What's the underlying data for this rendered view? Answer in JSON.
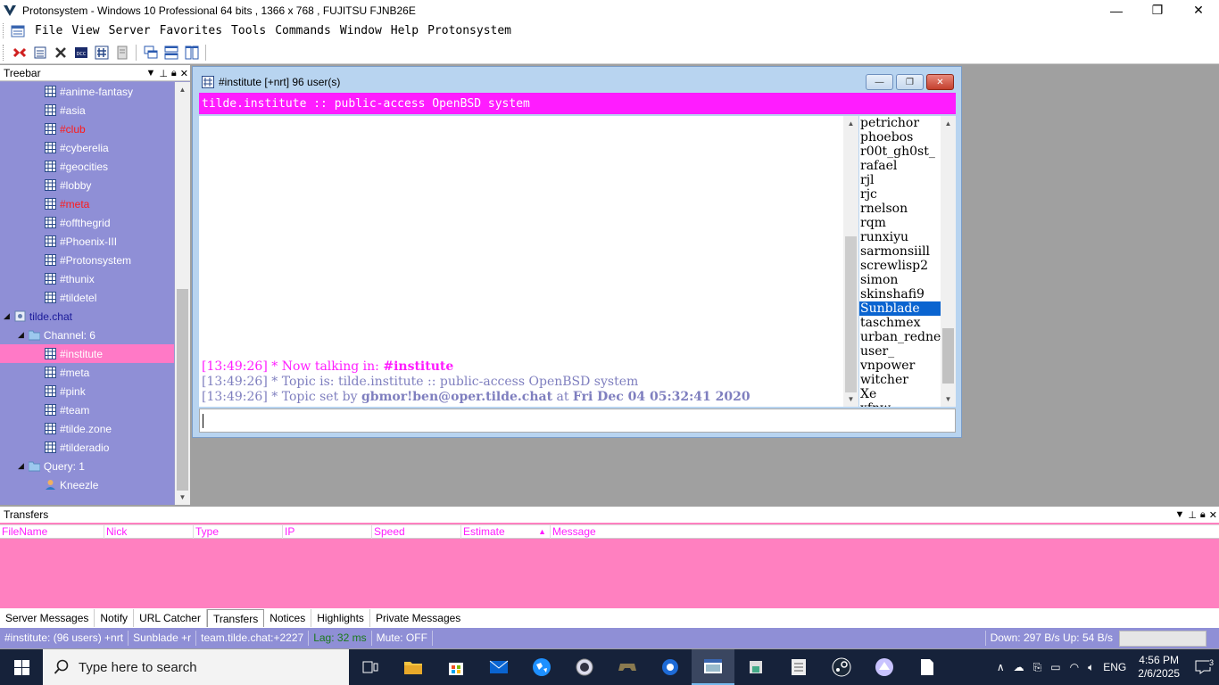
{
  "app": {
    "title": "Protonsystem - Windows 10 Professional 64 bits , 1366 x 768 , FUJITSU FJNB26E",
    "window_buttons": {
      "minimize": "—",
      "restore": "❐",
      "close": "✕"
    }
  },
  "menu": [
    "File",
    "View",
    "Server",
    "Favorites",
    "Tools",
    "Commands",
    "Window",
    "Help",
    "Protonsystem"
  ],
  "treebar": {
    "header": "Treebar",
    "items": [
      {
        "label": "#anime-fantasy",
        "kind": "channel",
        "indent": 2,
        "state": "normal"
      },
      {
        "label": "#asia",
        "kind": "channel",
        "indent": 2,
        "state": "normal"
      },
      {
        "label": "#club",
        "kind": "channel",
        "indent": 2,
        "state": "red"
      },
      {
        "label": "#cyberelia",
        "kind": "channel",
        "indent": 2,
        "state": "normal"
      },
      {
        "label": "#geocities",
        "kind": "channel",
        "indent": 2,
        "state": "normal"
      },
      {
        "label": "#lobby",
        "kind": "channel",
        "indent": 2,
        "state": "normal"
      },
      {
        "label": "#meta",
        "kind": "channel",
        "indent": 2,
        "state": "red"
      },
      {
        "label": "#offthegrid",
        "kind": "channel",
        "indent": 2,
        "state": "normal"
      },
      {
        "label": "#Phoenix-III",
        "kind": "channel",
        "indent": 2,
        "state": "normal"
      },
      {
        "label": "#Protonsystem",
        "kind": "channel",
        "indent": 2,
        "state": "normal"
      },
      {
        "label": "#thunix",
        "kind": "channel",
        "indent": 2,
        "state": "normal"
      },
      {
        "label": "#tildetel",
        "kind": "channel",
        "indent": 2,
        "state": "normal"
      },
      {
        "label": "tilde.chat",
        "kind": "server",
        "indent": 0,
        "state": "blue"
      },
      {
        "label": "Channel: 6",
        "kind": "folder",
        "indent": 1,
        "state": "normal"
      },
      {
        "label": "#institute",
        "kind": "channel",
        "indent": 2,
        "state": "selected"
      },
      {
        "label": "#meta",
        "kind": "channel",
        "indent": 2,
        "state": "normal"
      },
      {
        "label": "#pink",
        "kind": "channel",
        "indent": 2,
        "state": "normal"
      },
      {
        "label": "#team",
        "kind": "channel",
        "indent": 2,
        "state": "normal"
      },
      {
        "label": "#tilde.zone",
        "kind": "channel",
        "indent": 2,
        "state": "normal"
      },
      {
        "label": "#tilderadio",
        "kind": "channel",
        "indent": 2,
        "state": "normal"
      },
      {
        "label": "Query: 1",
        "kind": "folder",
        "indent": 1,
        "state": "normal"
      },
      {
        "label": "Kneezle",
        "kind": "query",
        "indent": 2,
        "state": "normal"
      }
    ]
  },
  "channel": {
    "window_title": "#institute [+nrt] 96 user(s)",
    "topic": "tilde.institute :: public-access OpenBSD system",
    "messages": [
      {
        "time": "[13:49:26]",
        "prefix": "* Now talking in: ",
        "bold": "#institute",
        "rest": "",
        "bold2": "",
        "type": "cur"
      },
      {
        "time": "[13:49:26]",
        "prefix": "* Topic is: tilde.institute :: public-access OpenBSD system",
        "bold": "",
        "rest": "",
        "bold2": "",
        "type": "info"
      },
      {
        "time": "[13:49:26]",
        "prefix": "* Topic set by ",
        "bold": "gbmor!ben@oper.tilde.chat",
        "rest": " at ",
        "bold2": "Fri Dec 04 05:32:41 2020",
        "type": "info"
      }
    ],
    "nicks": [
      "petrichor",
      "phoebos",
      "r00t_gh0st_",
      "rafael",
      "rjl",
      "rjc",
      "rnelson",
      "rqm",
      "runxiyu",
      "sarmonsiill",
      "screwlisp2",
      "simon",
      "skinshafi9",
      "Sunblade",
      "taschmex",
      "urban_redneck",
      "user_",
      "vnpower",
      "witcher",
      "Xe",
      "xfnw"
    ],
    "selected_nick": "Sunblade",
    "input_value": ""
  },
  "transfers": {
    "header": "Transfers",
    "columns": [
      "FileName",
      "Nick",
      "Type",
      "IP",
      "Speed",
      "Estimate",
      "Message"
    ]
  },
  "tabs": [
    "Server Messages",
    "Notify",
    "URL Catcher",
    "Transfers",
    "Notices",
    "Highlights",
    "Private Messages"
  ],
  "active_tab": "Transfers",
  "status": {
    "channel": "#institute: (96 users) +nrt",
    "nick": "Sunblade +r",
    "server": "team.tilde.chat:+2227",
    "lag": "Lag: 32 ms",
    "mute": "Mute: OFF",
    "rate": "Down: 297 B/s Up: 54 B/s"
  },
  "taskbar": {
    "search_placeholder": "Type here to search",
    "lang": "ENG",
    "time": "4:56 PM",
    "date": "2/6/2025",
    "notifications": "3"
  },
  "colors": {
    "topic_bg": "#ff1cff",
    "tree_bg": "#8f8fd6",
    "selection": "#ff79c6",
    "nick_selected": "#0a64d0",
    "transfers_bg": "#ff80c0"
  }
}
